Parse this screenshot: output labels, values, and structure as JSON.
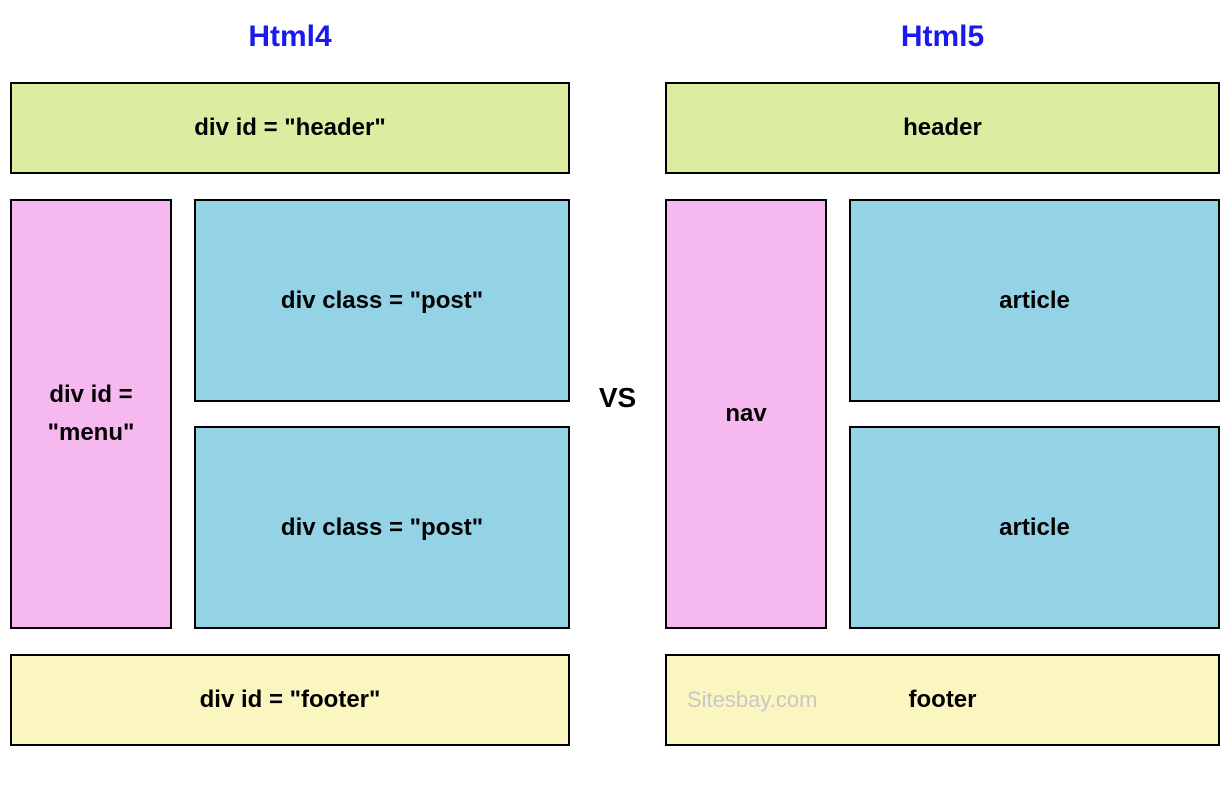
{
  "diagram": {
    "left": {
      "title": "Html4",
      "header": "div id = \"header\"",
      "menu": "div id = \"menu\"",
      "post1": "div class = \"post\"",
      "post2": "div class = \"post\"",
      "footer": "div id = \"footer\""
    },
    "vs": "VS",
    "right": {
      "title": "Html5",
      "header": "header",
      "nav": "nav",
      "article1": "article",
      "article2": "article",
      "footer": "footer",
      "watermark": "Sitesbay.com"
    }
  }
}
